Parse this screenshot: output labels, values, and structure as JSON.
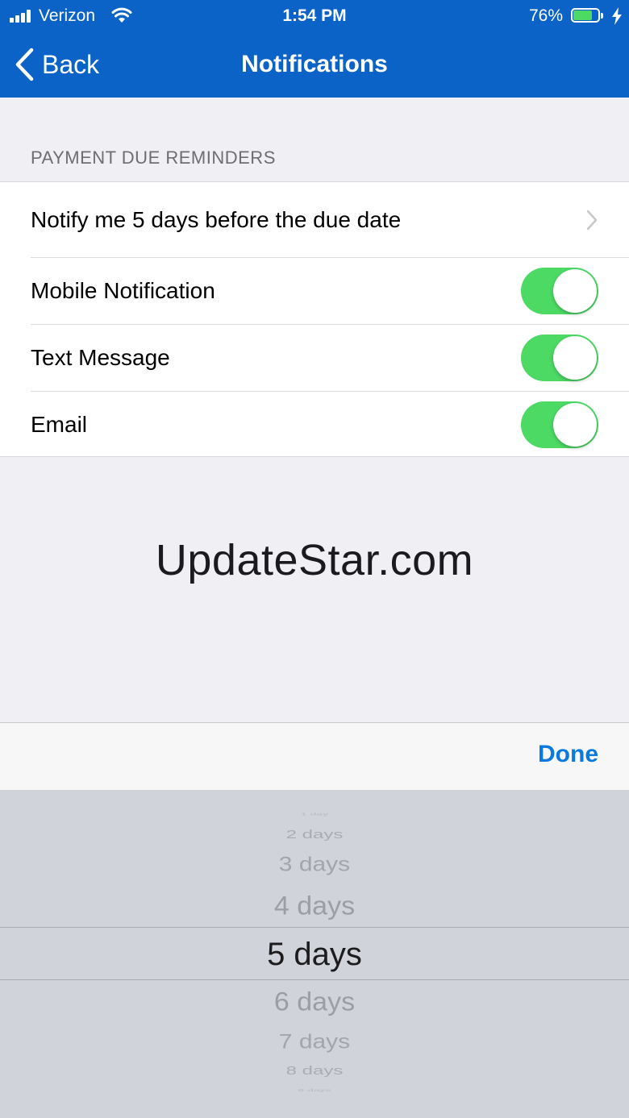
{
  "status_bar": {
    "carrier": "Verizon",
    "time": "1:54 PM",
    "battery_text": "76%",
    "battery_level": 0.76,
    "battery_color": "#4cd964"
  },
  "nav": {
    "back_label": "Back",
    "title": "Notifications",
    "background": "#0b63c8"
  },
  "section": {
    "header": "PAYMENT DUE REMINDERS",
    "reminder_label": "Notify me 5 days before the due date",
    "toggles": [
      {
        "label": "Mobile Notification",
        "on": true
      },
      {
        "label": "Text Message",
        "on": true
      },
      {
        "label": "Email",
        "on": true
      }
    ],
    "toggle_on_color": "#4cd964"
  },
  "watermark": "UpdateStar.com",
  "toolbar": {
    "done_label": "Done",
    "accent": "#0b7ae0"
  },
  "picker": {
    "options": [
      "1 day",
      "2 days",
      "3 days",
      "4 days",
      "5 days",
      "6 days",
      "7 days",
      "8 days",
      "9 days"
    ],
    "selected": "5 days"
  }
}
